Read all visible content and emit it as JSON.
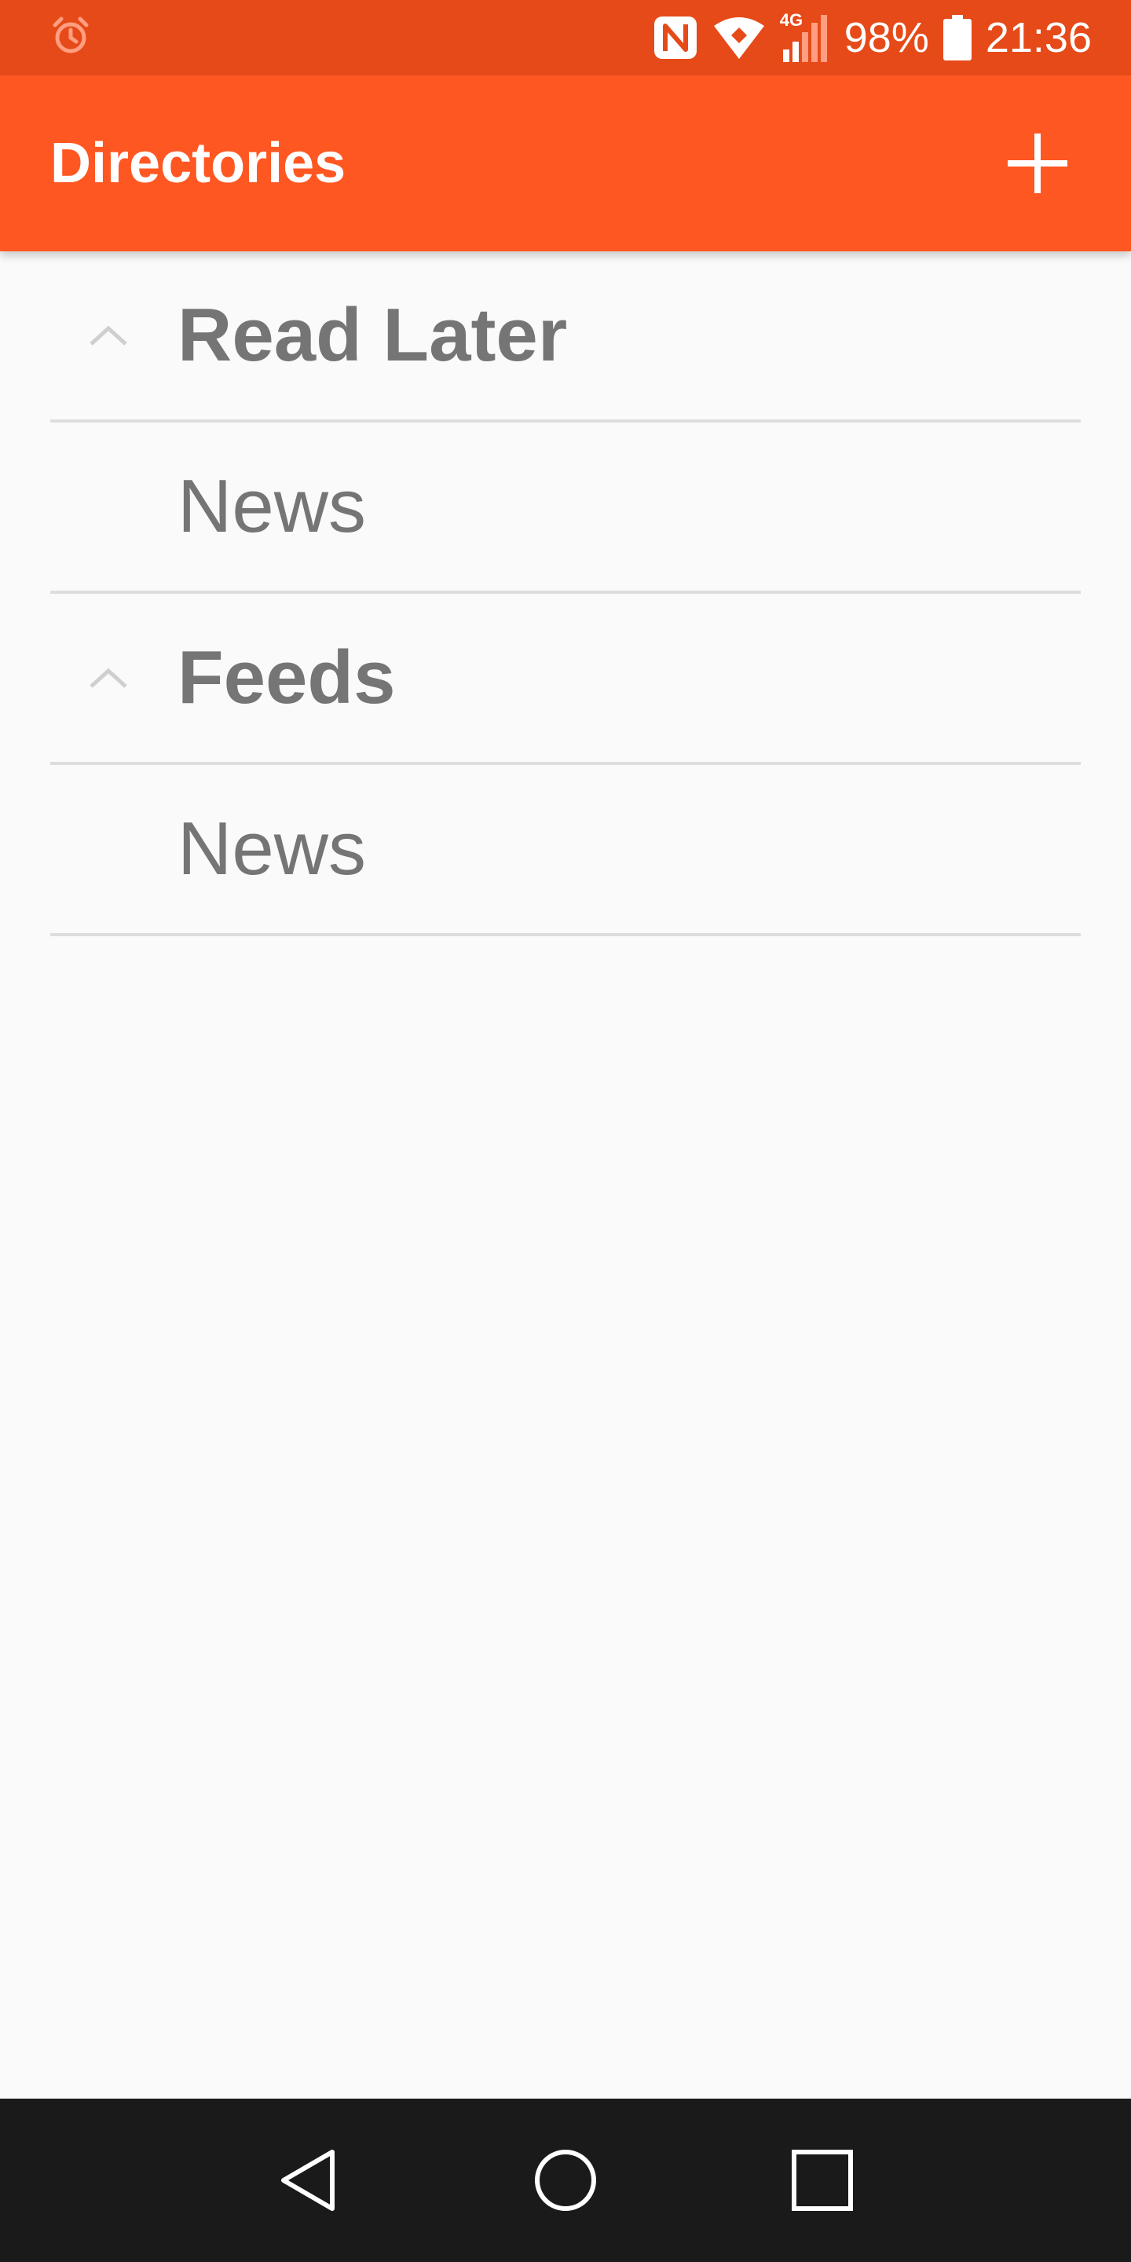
{
  "status_bar": {
    "battery": "98%",
    "time": "21:36",
    "network": "4G",
    "icons": [
      "alarm-icon",
      "nfc-icon",
      "wifi-icon",
      "signal-icon",
      "battery-icon"
    ]
  },
  "app_bar": {
    "title": "Directories",
    "add_icon": "plus-icon"
  },
  "directories": [
    {
      "name": "Read Later",
      "expanded": true,
      "items": [
        "News"
      ]
    },
    {
      "name": "Feeds",
      "expanded": true,
      "items": [
        "News"
      ]
    }
  ],
  "labels": {
    "group_0": "Read Later",
    "group_0_item_0": "News",
    "group_1": "Feeds",
    "group_1_item_0": "News"
  },
  "colors": {
    "status_bar": "#e64a19",
    "app_bar": "#ff5722",
    "background": "#fafafa",
    "text": "#757575",
    "divider": "#dddddd",
    "nav_bar": "#1a1a1a"
  },
  "nav_bar": {
    "icons": [
      "back-icon",
      "home-icon",
      "recents-icon"
    ]
  }
}
